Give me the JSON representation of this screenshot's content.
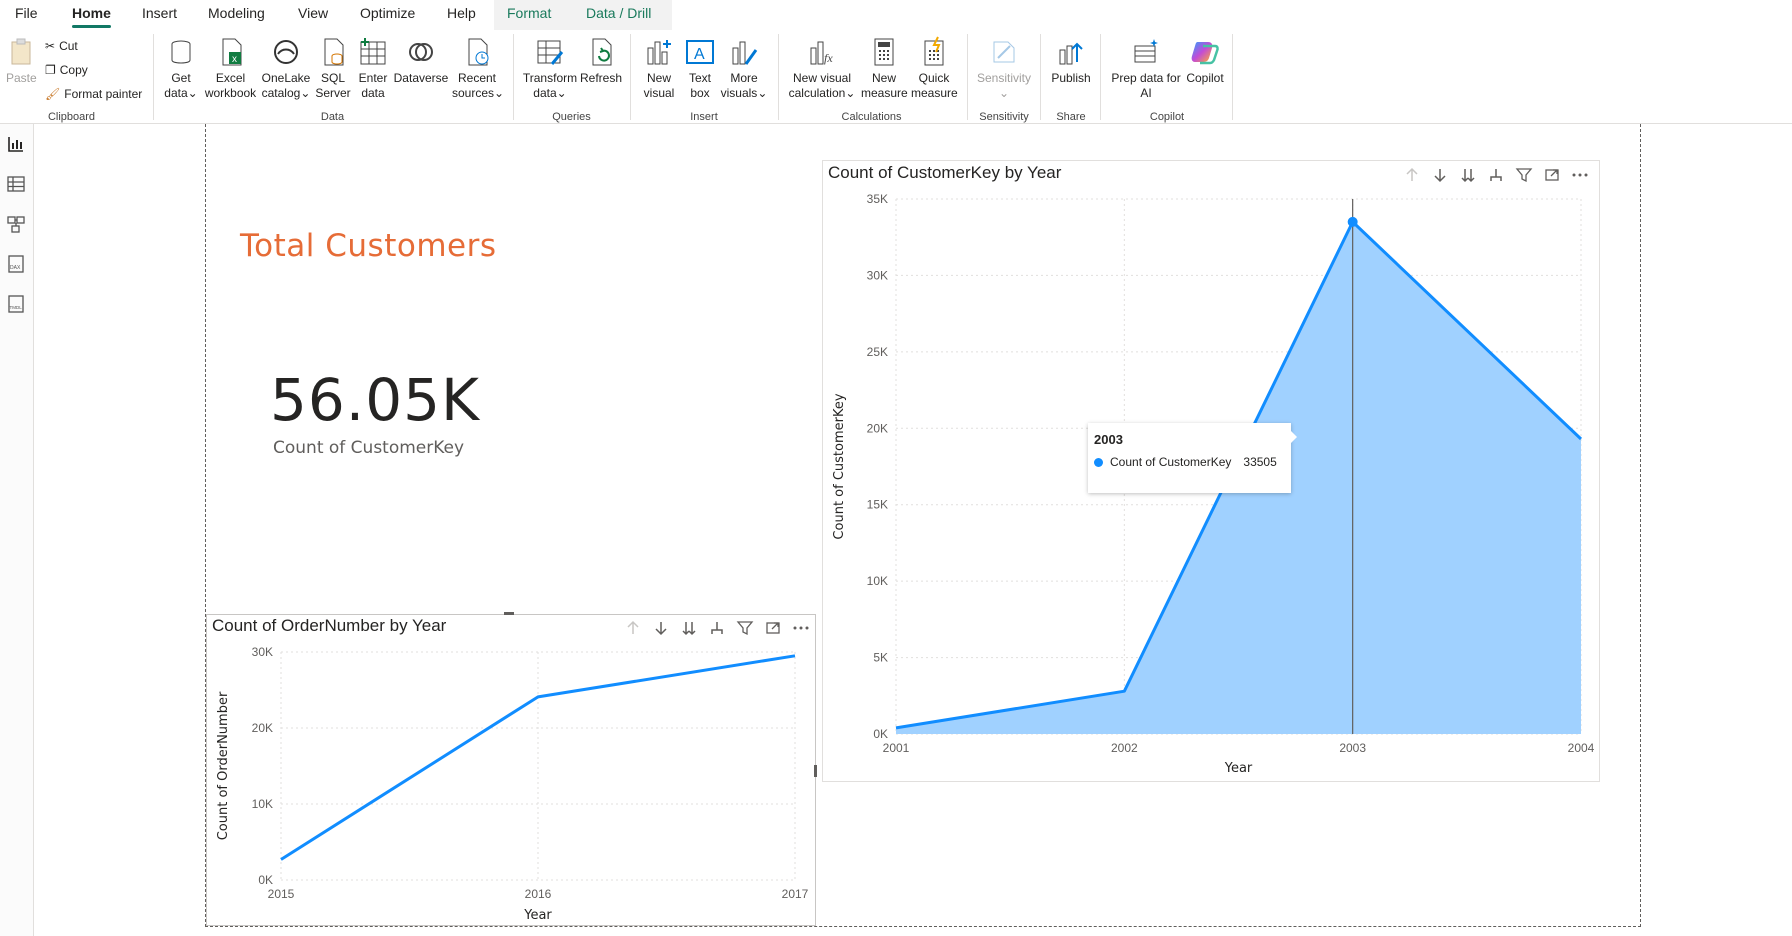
{
  "menu": {
    "items": [
      "File",
      "Home",
      "Insert",
      "Modeling",
      "View",
      "Optimize",
      "Help",
      "Format",
      "Data / Drill"
    ],
    "active": "Home"
  },
  "ribbon": {
    "clipboard": {
      "paste": "Paste",
      "cut": "Cut",
      "copy": "Copy",
      "format_painter": "Format painter",
      "group": "Clipboard"
    },
    "data": {
      "get_data": [
        "Get",
        "data"
      ],
      "excel": [
        "Excel",
        "workbook"
      ],
      "onelake": [
        "OneLake",
        "catalog"
      ],
      "sql": [
        "SQL",
        "Server"
      ],
      "enter": [
        "Enter",
        "data"
      ],
      "dataverse": [
        "Dataverse",
        ""
      ],
      "recent": [
        "Recent",
        "sources"
      ],
      "group": "Data"
    },
    "queries": {
      "transform": [
        "Transform",
        "data"
      ],
      "refresh": [
        "Refresh",
        ""
      ],
      "group": "Queries"
    },
    "insert": {
      "new_visual": [
        "New",
        "visual"
      ],
      "text_box": [
        "Text",
        "box"
      ],
      "more_visuals": [
        "More",
        "visuals"
      ],
      "group": "Insert"
    },
    "calculations": {
      "new_visual_calc": [
        "New visual",
        "calculation"
      ],
      "new_measure": [
        "New",
        "measure"
      ],
      "quick_measure": [
        "Quick",
        "measure"
      ],
      "group": "Calculations"
    },
    "sensitivity": {
      "label": "Sensitivity",
      "group": "Sensitivity"
    },
    "share": {
      "publish": "Publish",
      "group": "Share"
    },
    "copilot": {
      "prep": [
        "Prep data for",
        "AI"
      ],
      "copilot": "Copilot",
      "group": "Copilot"
    }
  },
  "card": {
    "title": "Total Customers",
    "value": "56.05K",
    "label": "Count of CustomerKey",
    "title_color": "#e66c37"
  },
  "tooltip": {
    "header": "2003",
    "series": "Count of CustomerKey",
    "value": "33505"
  },
  "chart_data": [
    {
      "type": "area",
      "title": "Count of CustomerKey by Year",
      "xlabel": "Year",
      "ylabel": "Count of CustomerKey",
      "x": [
        "2001",
        "2002",
        "2003",
        "2004"
      ],
      "series": [
        {
          "values": [
            400,
            2800,
            33505,
            19300
          ]
        }
      ],
      "ylim": [
        0,
        35000
      ],
      "yticks": [
        "0K",
        "5K",
        "10K",
        "15K",
        "20K",
        "25K",
        "30K",
        "35K"
      ],
      "grid": true,
      "line_color": "#118dff",
      "fill_color": "#a0d1ff"
    },
    {
      "type": "line",
      "title": "Count of OrderNumber by Year",
      "xlabel": "Year",
      "ylabel": "Count of OrderNumber",
      "x": [
        "2015",
        "2016",
        "2017"
      ],
      "series": [
        {
          "values": [
            2700,
            24100,
            29500
          ]
        }
      ],
      "ylim": [
        0,
        30000
      ],
      "yticks": [
        "0K",
        "10K",
        "20K",
        "30K"
      ],
      "grid": true,
      "line_color": "#118dff"
    }
  ]
}
